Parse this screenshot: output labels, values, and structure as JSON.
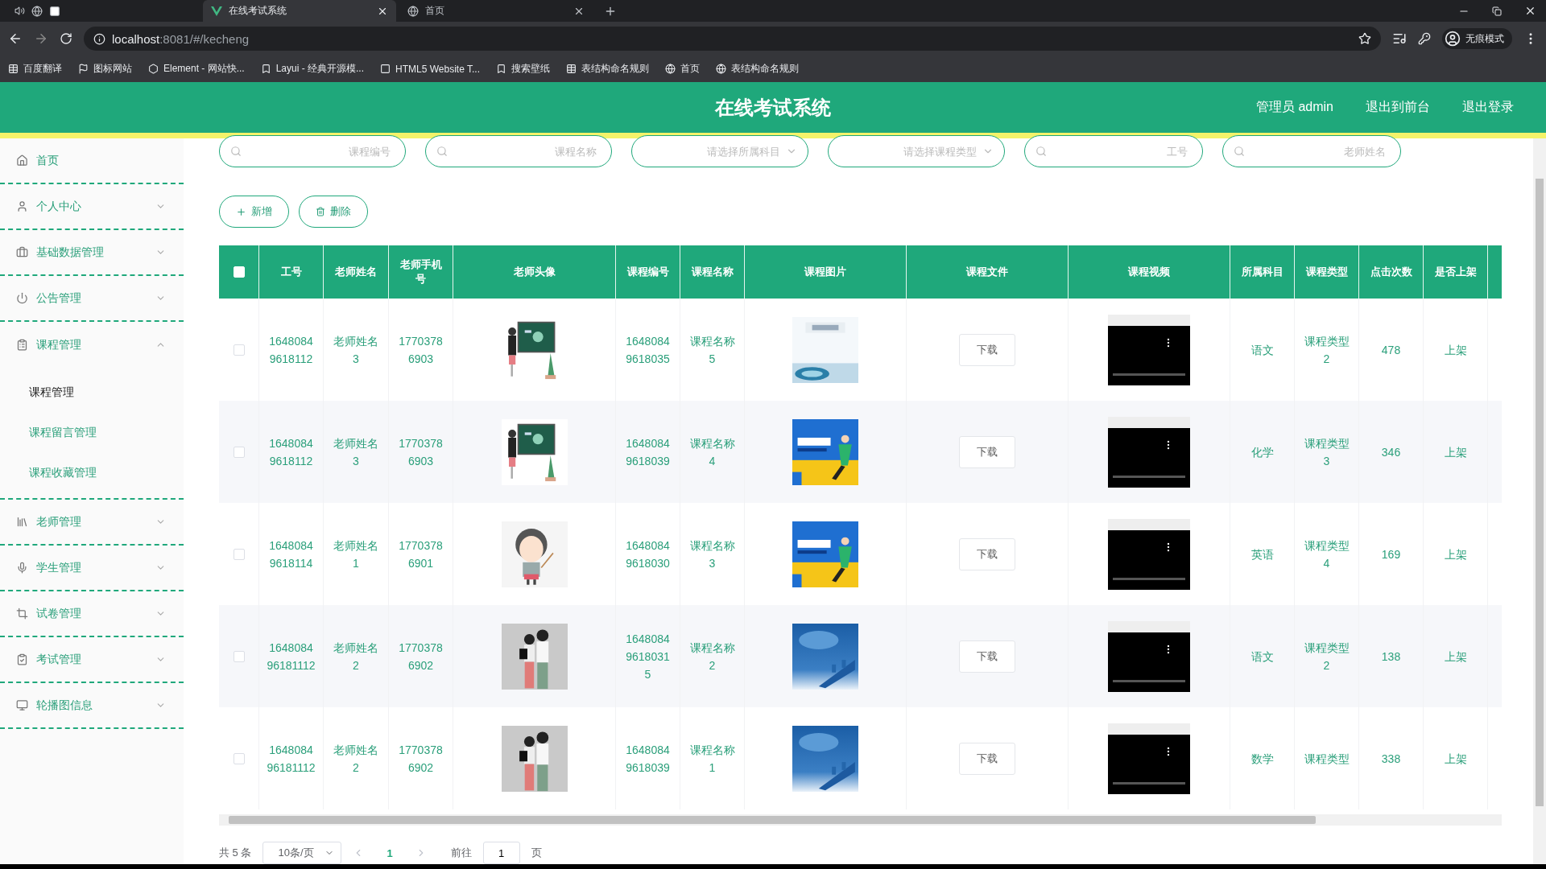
{
  "browser": {
    "tabs": [
      {
        "title": "在线考试系统",
        "selected": true
      },
      {
        "title": "首页",
        "selected": false
      }
    ],
    "url_host": "localhost",
    "url_path": ":8081/#/kecheng",
    "bookmarks": [
      "百度翻译",
      "图标网站",
      "Element - 网站快...",
      "Layui - 经典开源模...",
      "HTML5 Website T...",
      "搜索壁纸",
      "表结构命名规则",
      "首页",
      "表结构命名规则"
    ],
    "profile_label": "无痕模式"
  },
  "header": {
    "title": "在线考试系统",
    "user": "管理员 admin",
    "links": [
      "退出到前台",
      "退出登录"
    ]
  },
  "sidebar": [
    {
      "kind": "link",
      "label": "首页"
    },
    {
      "kind": "menu",
      "label": "个人中心",
      "expanded": false
    },
    {
      "kind": "menu",
      "label": "基础数据管理",
      "expanded": false
    },
    {
      "kind": "menu",
      "label": "公告管理",
      "expanded": false
    },
    {
      "kind": "menu",
      "label": "课程管理",
      "expanded": true,
      "children": [
        {
          "label": "课程管理",
          "selected": true
        },
        {
          "label": "课程留言管理",
          "selected": false
        },
        {
          "label": "课程收藏管理",
          "selected": false
        }
      ]
    },
    {
      "kind": "menu",
      "label": "老师管理",
      "expanded": false
    },
    {
      "kind": "menu",
      "label": "学生管理",
      "expanded": false
    },
    {
      "kind": "menu",
      "label": "试卷管理",
      "expanded": false
    },
    {
      "kind": "menu",
      "label": "考试管理",
      "expanded": false
    },
    {
      "kind": "menu",
      "label": "轮播图信息",
      "expanded": false
    }
  ],
  "filters": [
    {
      "kind": "search",
      "placeholder": "课程编号"
    },
    {
      "kind": "search",
      "placeholder": "课程名称"
    },
    {
      "kind": "select",
      "placeholder": "请选择所属科目"
    },
    {
      "kind": "select",
      "placeholder": "请选择课程类型"
    },
    {
      "kind": "search",
      "placeholder": "工号"
    },
    {
      "kind": "search",
      "placeholder": "老师姓名"
    }
  ],
  "actions": [
    {
      "kind": "add",
      "label": "新增"
    },
    {
      "kind": "delete",
      "label": "删除"
    }
  ],
  "table": {
    "all_checked": false,
    "columns": [
      "工号",
      "老师姓名",
      "老师手机号",
      "老师头像",
      "课程编号",
      "课程名称",
      "课程图片",
      "课程文件",
      "课程视频",
      "所属科目",
      "课程类型",
      "点击次数",
      "是否上架"
    ],
    "rows": [
      {
        "checked": false,
        "id": "16480849618112",
        "teacher": "老师姓名3",
        "phone": "17703786903",
        "course_no": "16480849618035",
        "course_name": "课程名称5",
        "file_button": "下载",
        "subject": "语文",
        "course_type": "课程类型2",
        "clicks": "478",
        "status": "上架"
      },
      {
        "checked": false,
        "id": "16480849618112",
        "teacher": "老师姓名3",
        "phone": "17703786903",
        "course_no": "16480849618039",
        "course_name": "课程名称4",
        "file_button": "下载",
        "subject": "化学",
        "course_type": "课程类型3",
        "clicks": "346",
        "status": "上架"
      },
      {
        "checked": false,
        "id": "16480849618114",
        "teacher": "老师姓名1",
        "phone": "17703786901",
        "course_no": "16480849618030",
        "course_name": "课程名称3",
        "file_button": "下载",
        "subject": "英语",
        "course_type": "课程类型4",
        "clicks": "169",
        "status": "上架"
      },
      {
        "checked": false,
        "id": "164808496181112",
        "teacher": "老师姓名2",
        "phone": "17703786902",
        "course_no": "164808496180315",
        "course_name": "课程名称2",
        "file_button": "下载",
        "subject": "语文",
        "course_type": "课程类型2",
        "clicks": "138",
        "status": "上架"
      },
      {
        "checked": false,
        "id": "164808496181112",
        "teacher": "老师姓名2",
        "phone": "17703786902",
        "course_no": "16480849618039",
        "course_name": "课程名称1",
        "file_button": "下载",
        "subject": "数学",
        "course_type": "课程类型",
        "clicks": "338",
        "status": "上架"
      }
    ]
  },
  "pagination": {
    "total": "共 5 条",
    "page_size": "10条/页",
    "pages": [
      {
        "label": "1",
        "selected": true
      }
    ],
    "goto_label": "前往",
    "goto_value": "1",
    "goto_suffix": "页"
  }
}
